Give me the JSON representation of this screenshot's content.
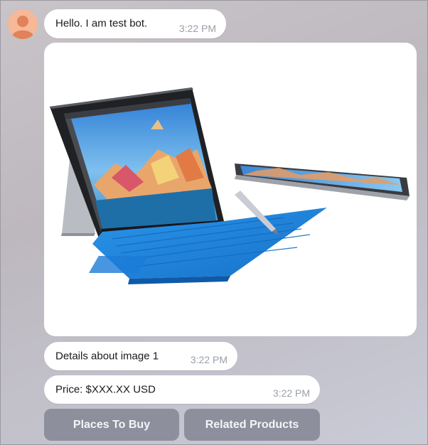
{
  "messages": [
    {
      "text": "Hello. I am test bot.",
      "time": "3:22 PM"
    },
    {
      "text": "Details about image 1",
      "time": "3:22 PM"
    },
    {
      "text": "Price: $XXX.XX USD",
      "time": "3:22 PM"
    }
  ],
  "image": {
    "icon": "product-photo-laptop-tablet"
  },
  "buttons": {
    "places": "Places To Buy",
    "related": "Related Products"
  },
  "colors": {
    "bubble": "#ffffff",
    "button": "#8d8f9d",
    "keyboard": "#1f86e0",
    "avatar": "#f5b28c"
  }
}
